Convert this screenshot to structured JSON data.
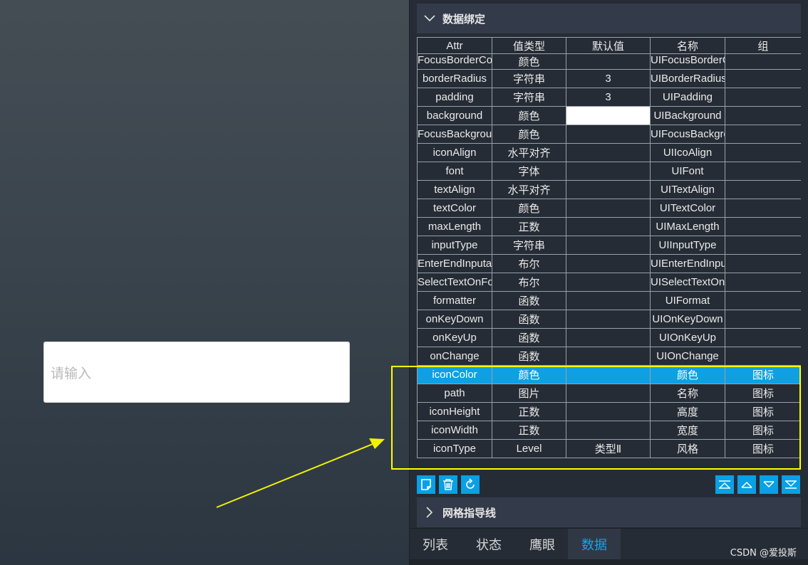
{
  "preview": {
    "placeholder": "请输入"
  },
  "panel": {
    "section_title": "数据绑定",
    "grid_section_title": "网格指导线",
    "columns": [
      "Attr",
      "值类型",
      "默认值",
      "名称",
      "组"
    ],
    "rows": [
      [
        "FocusBorderColor",
        "颜色",
        "",
        "UIFocusBorderColor",
        ""
      ],
      [
        "borderRadius",
        "字符串",
        "3",
        "UIBorderRadius",
        ""
      ],
      [
        "padding",
        "字符串",
        "3",
        "UIPadding",
        ""
      ],
      [
        "background",
        "颜色",
        "",
        "UIBackground",
        ""
      ],
      [
        "FocusBackground",
        "颜色",
        "",
        "UIFocusBackground",
        ""
      ],
      [
        "iconAlign",
        "水平对齐",
        "",
        "UIIcoAlign",
        ""
      ],
      [
        "font",
        "字体",
        "",
        "UIFont",
        ""
      ],
      [
        "textAlign",
        "水平对齐",
        "",
        "UITextAlign",
        ""
      ],
      [
        "textColor",
        "颜色",
        "",
        "UITextColor",
        ""
      ],
      [
        "maxLength",
        "正数",
        "",
        "UIMaxLength",
        ""
      ],
      [
        "inputType",
        "字符串",
        "",
        "UIInputType",
        ""
      ],
      [
        "EnterEndInputable",
        "布尔",
        "",
        "UIEnterEndInputable",
        ""
      ],
      [
        "SelectTextOnFocus",
        "布尔",
        "",
        "UISelectTextOnFocus",
        ""
      ],
      [
        "formatter",
        "函数",
        "",
        "UIFormat",
        ""
      ],
      [
        "onKeyDown",
        "函数",
        "",
        "UIOnKeyDown",
        ""
      ],
      [
        "onKeyUp",
        "函数",
        "",
        "UIOnKeyUp",
        ""
      ],
      [
        "onChange",
        "函数",
        "",
        "UIOnChange",
        ""
      ],
      [
        "iconColor",
        "颜色",
        "",
        "颜色",
        "图标"
      ],
      [
        "path",
        "图片",
        "",
        "名称",
        "图标"
      ],
      [
        "iconHeight",
        "正数",
        "",
        "高度",
        "图标"
      ],
      [
        "iconWidth",
        "正数",
        "",
        "宽度",
        "图标"
      ],
      [
        "iconType",
        "Level",
        "类型Ⅱ",
        "风格",
        "图标"
      ]
    ],
    "selected_row": "iconColor",
    "tabs": [
      "列表",
      "状态",
      "鹰眼",
      "数据"
    ],
    "active_tab": "数据"
  },
  "watermark": "CSDN @爱投斯",
  "colors": {
    "accent": "#0ea0e2",
    "highlight": "#ffff00",
    "panel": "#262c35",
    "header": "#333b4a"
  }
}
